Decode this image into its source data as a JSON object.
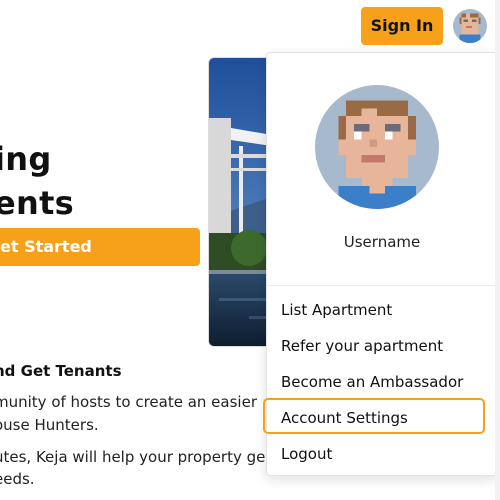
{
  "header": {
    "signin_label": "Sign In",
    "avatar_icon": "pixel-avatar-icon"
  },
  "hero": {
    "line1": "ing",
    "line2": "ents",
    "cta_label": "et Started"
  },
  "section": {
    "heading": "nd Get Tenants",
    "paragraphs": [
      "munity of hosts to create an easier",
      "ouse Hunters.",
      "utes, Keja will help your property ge",
      "eeds."
    ]
  },
  "dropdown": {
    "username": "Username",
    "items": [
      {
        "label": "List Apartment"
      },
      {
        "label": "Refer your apartment"
      },
      {
        "label": "Become an Ambassador"
      },
      {
        "label": "Account Settings",
        "highlighted": true
      },
      {
        "label": "Logout"
      }
    ]
  },
  "colors": {
    "accent": "#f7a11a",
    "avatar_bg": "#a7b9cc"
  }
}
